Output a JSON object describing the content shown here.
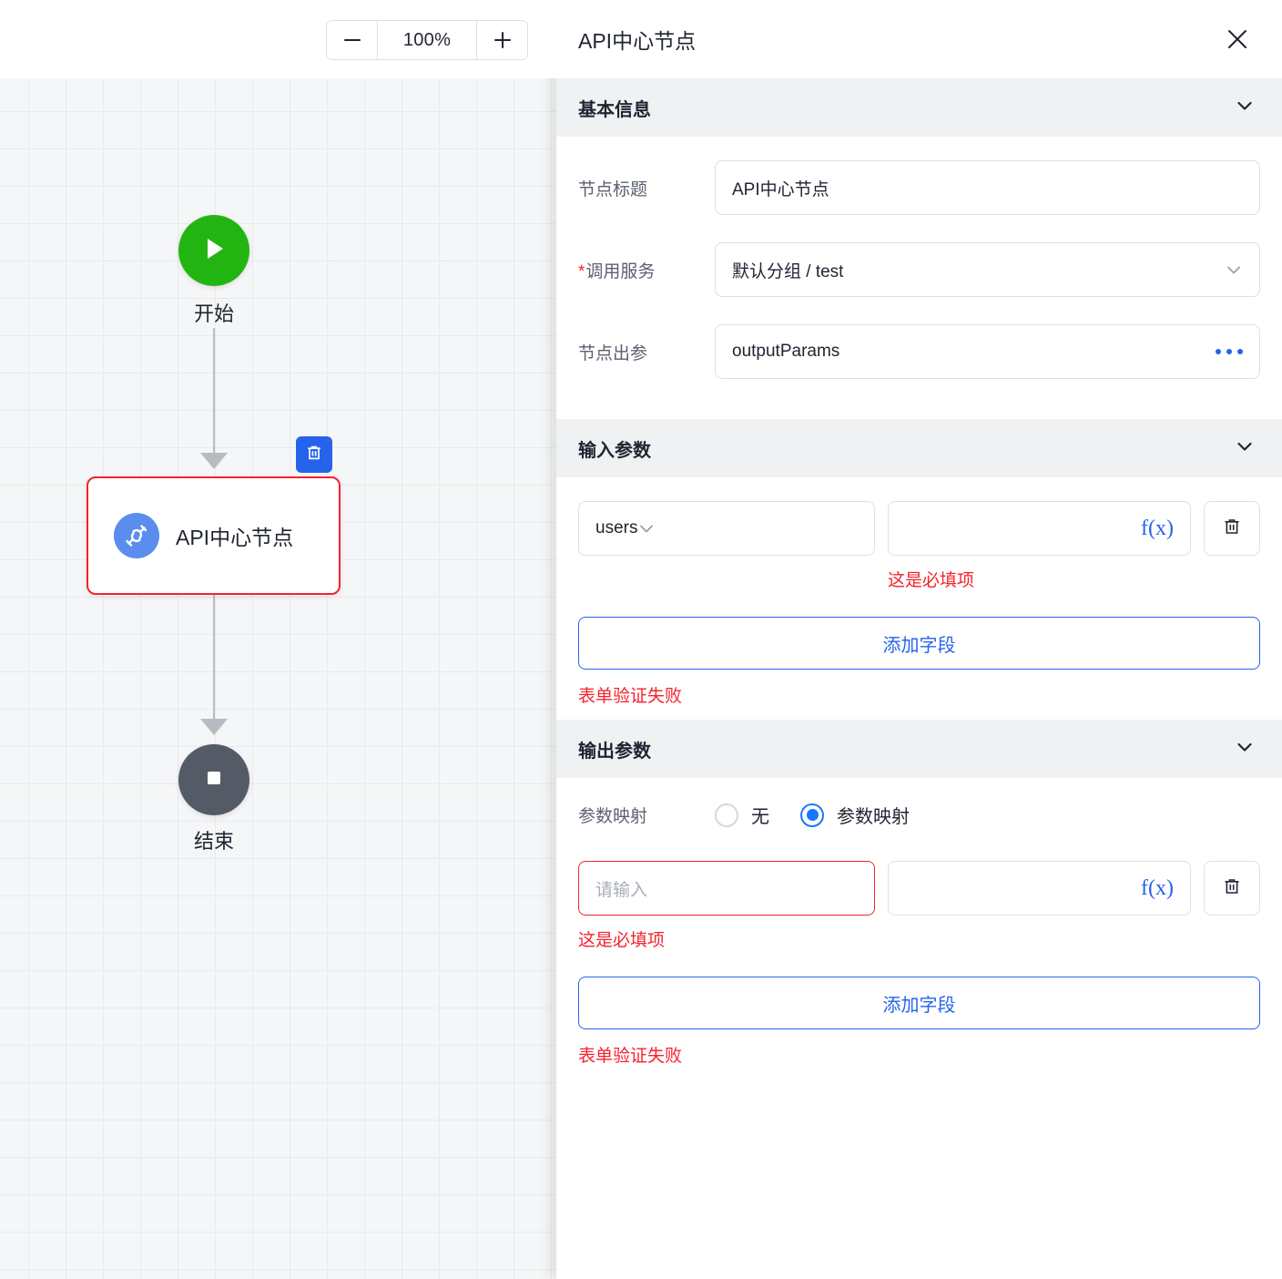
{
  "canvas": {
    "zoom": {
      "level": "100%",
      "minus_label": "缩小",
      "plus_label": "放大"
    },
    "nodes": [
      {
        "id": "start",
        "label": "开始",
        "icon": "play-icon",
        "color": "#22b511"
      },
      {
        "id": "api",
        "label": "API中心节点",
        "icon": "plug-icon",
        "color": "#5b8def",
        "selected": true,
        "border_color": "#f5222d"
      },
      {
        "id": "end",
        "label": "结束",
        "icon": "stop-icon",
        "color": "#555b66"
      }
    ],
    "delete_button": {
      "icon": "trash-icon",
      "color": "#2563eb"
    }
  },
  "panel": {
    "title": "API中心节点",
    "close_icon": "close-icon",
    "sections": {
      "basic": {
        "title": "基本信息",
        "chevron": "chevron-down-icon",
        "fields": {
          "node_title": {
            "label": "节点标题",
            "value": "API中心节点"
          },
          "service": {
            "label": "调用服务",
            "required": true,
            "required_mark": "*",
            "value": "默认分组 / test",
            "chevron": "chevron-down-icon"
          },
          "output": {
            "label": "节点出参",
            "value": "outputParams",
            "action_icon": "ellipsis-icon"
          }
        }
      },
      "input_params": {
        "title": "输入参数",
        "chevron": "chevron-down-icon",
        "rows": [
          {
            "key": "users",
            "key_chevron": "chevron-down-icon",
            "value": "",
            "fx_label": "f(x)",
            "trash_icon": "trash-icon",
            "error": "这是必填项"
          }
        ],
        "add_button": "添加字段",
        "form_error": "表单验证失败"
      },
      "output_params": {
        "title": "输出参数",
        "chevron": "chevron-down-icon",
        "mapping": {
          "label": "参数映射",
          "options": [
            {
              "label": "无",
              "selected": false
            },
            {
              "label": "参数映射",
              "selected": true
            }
          ]
        },
        "rows": [
          {
            "key": "",
            "key_placeholder": "请输入",
            "key_error": true,
            "value": "",
            "fx_label": "f(x)",
            "trash_icon": "trash-icon",
            "error": "这是必填项"
          }
        ],
        "add_button": "添加字段",
        "form_error": "表单验证失败"
      }
    }
  },
  "colors": {
    "primary": "#2563eb",
    "radio_accent": "#1677ff",
    "error": "#f5222d",
    "start_green": "#22b511",
    "end_gray": "#555b66",
    "api_blue": "#5b8def"
  }
}
